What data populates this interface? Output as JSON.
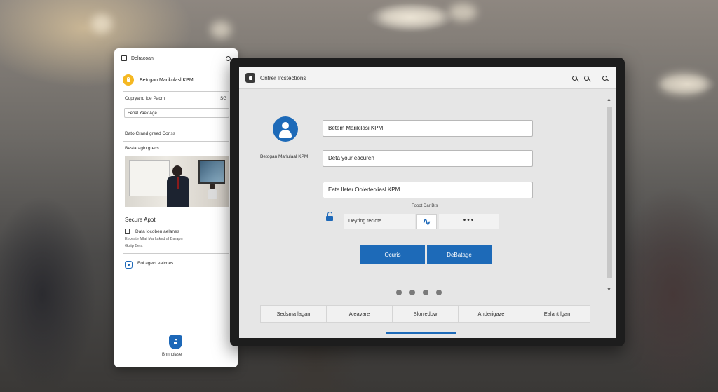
{
  "phone": {
    "header_label": "Delracoan",
    "org_name": "Betogan Marikulasl KPM",
    "field_label": "Copryand loe Pacm",
    "field_suffix": "SG",
    "field_value": "Feoal Yaek Age",
    "section_label": "Dato Crand greed Conss",
    "photo_caption": "Bestaragin grecs",
    "secure_title": "Secure Apot",
    "checkbox_label": "Data locoben aelanes",
    "note_line1": "Ezceate Mlat Marltaked al Barapn",
    "note_line2": "Goiip Bela",
    "lock_link_label": "Eol agect ealcnes",
    "footer_label": "Bnnnolase"
  },
  "tablet": {
    "title": "Onfrer Ircstections",
    "avatar_caption": "Betogan Marlulaal KPM",
    "input1_value": "Betem Marikilasi KPM",
    "input2_value": "Deta your eacuren",
    "input3_value": "Eata lleter Oolerfeoliasl KPM",
    "small_label": "Fooot Dar Brs",
    "segment_label": "Deyring reclote",
    "segment_link_glyph": "∿",
    "segment_more": "•••",
    "button1": "Ocuris",
    "button2": "DeBatage",
    "tabs": [
      "Sedsma lagan",
      "Aleavare",
      "Slorredow",
      "Anderigaze",
      "Ealant lgan"
    ],
    "accent_color": "#1d6ab8"
  }
}
